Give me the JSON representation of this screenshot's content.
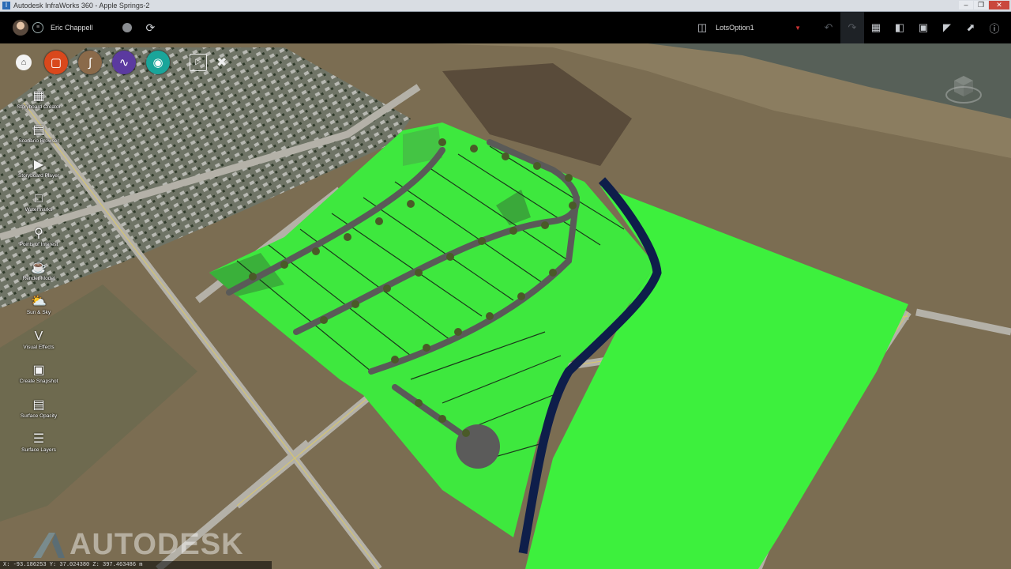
{
  "window": {
    "title": "Autodesk InfraWorks 360 - Apple Springs-2",
    "app_icon": "infraworks-icon"
  },
  "user": {
    "name": "Eric Chappell"
  },
  "topbar": {
    "proposal": "LotsOption1",
    "tools": [
      "proposal-icon",
      "undo-icon",
      "redo-icon",
      "table-icon",
      "panel-icon",
      "fullscreen-icon",
      "settings-icon",
      "select-icon",
      "help-icon"
    ]
  },
  "tool_circles": [
    {
      "name": "build-layout-icon",
      "color": "#d9481c"
    },
    {
      "name": "design-roads-icon",
      "color": "#8a6a4a"
    },
    {
      "name": "analyze-icon",
      "color": "#5b3aa0"
    },
    {
      "name": "visualize-icon",
      "color": "#1aa59a"
    }
  ],
  "left_panel": {
    "items": [
      {
        "label": "Storyboard Creator",
        "icon": "storyboard-creator-icon"
      },
      {
        "label": "Scenario Browser",
        "icon": "scenario-browser-icon"
      },
      {
        "label": "Storyboard Player",
        "icon": "storyboard-player-icon"
      },
      {
        "label": "Watermarks",
        "icon": "watermarks-icon"
      },
      {
        "label": "Points of Interest",
        "icon": "points-of-interest-icon"
      },
      {
        "label": "Render Model",
        "icon": "render-model-icon"
      },
      {
        "label": "Sun & Sky",
        "icon": "sun-sky-icon"
      },
      {
        "label": "Visual Effects",
        "icon": "visual-effects-icon"
      },
      {
        "label": "Create Snapshot",
        "icon": "create-snapshot-icon"
      },
      {
        "label": "Surface Opacity",
        "icon": "surface-opacity-icon"
      },
      {
        "label": "Surface Layers",
        "icon": "surface-layers-icon"
      }
    ]
  },
  "status": {
    "coordinates": "X: -93.186253  Y: 37.024380  Z: 397.463486 m"
  },
  "watermark": {
    "text": "AUTODESK"
  },
  "colors": {
    "parcel_green": "#3cf03c",
    "river": "#0e1e4a",
    "terrain": "#7b6d52"
  }
}
